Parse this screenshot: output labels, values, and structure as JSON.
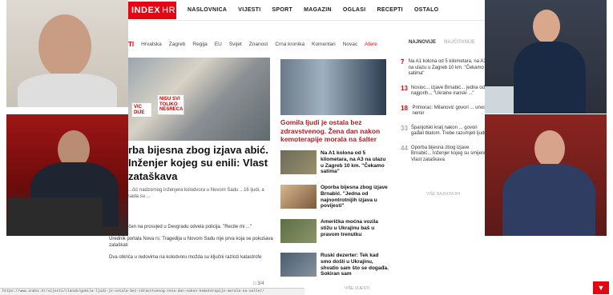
{
  "nav": {
    "logo": "INDEX",
    "logo_suffix": "HR",
    "items": [
      "NASLOVNICA",
      "VIJESTI",
      "SPORT",
      "MAGAZIN",
      "OGLASI",
      "RECEPTI",
      "OSTALO"
    ]
  },
  "subnav": {
    "prefix": "TI",
    "items": [
      "Hrvatska",
      "Zagreb",
      "Regija",
      "EU",
      "Svijet",
      "Znanost",
      "Crna kronika",
      "Komentari",
      "Novac"
    ],
    "alert": "Afere"
  },
  "tabs": {
    "active": "NAJNOVIJE",
    "inactive": "NAJČITANIJE"
  },
  "hero": {
    "signs": [
      "NISU SVI TOLIKO NESRECA",
      "VIC DIJE"
    ],
    "title": "rba bijesna zbog izjava abić. Inženjer kojeg su enili: Vlast zataškava",
    "sub": "...čić nadzornog inženjera kolodvora u Novom Sadu ...16 ljudi, a sada su ... "
  },
  "small_links": [
    "...je povučen na prosvjed u Devgradu odvela policija. \"Recite mi ...\"",
    "Urednik portala Nova rs: Tragedija u Novom Sadu nije prva koja se pokušava zataškati",
    "Dva otkrića u redovima na kolodvoru možda su ključni razlozi katastrofe"
  ],
  "comment_count": "3/4",
  "mid": {
    "title": "Gomila ljudi je ostala bez zdravstvenog. Žena dan nakon kemoterapije morala na šalter",
    "stories": [
      "Na A1 kolona od 5 kilometara, na A3 na ulazu u Zagreb 10 km. \"Čekamo satima\"",
      "Oporba bijesna zbog izjave Brnabić. \"Jedna od najnontrotnijih izjava u povijesti\"",
      "Američka mоćna vozila stižu u Ukrajinu baš u pravom trenutku",
      "Ruski dezerter: Tek kad smo došli u Ukrajinu, shvatio sam što se događa. Sokiran sam"
    ],
    "more": "VIŠE VIJESTI"
  },
  "right_list": [
    {
      "num": "7",
      "text": "Na A1 kolona od 5 kilometara, na A3 na ulazu u Zagreb 10 km. \"Čekamo satima\""
    },
    {
      "num": "13",
      "text": "Nosioc... izjave Brnabić... jedna od najgorih... \"Ukraine iranski ...\""
    },
    {
      "num": "18",
      "text": "Primorac: Milanović govori ... unosi nemir"
    },
    {
      "num": "33",
      "text": "Španjolski kralj nakon ... govori gađali blatom. Trebe razumjeti ljudi"
    },
    {
      "num": "44",
      "text": "Oporba bijesna zbog izjave Brnabić... Inženjer kojeg su smijenili: Vlast zataškava"
    }
  ],
  "right_more": "VIŠE NAJNOVIJIH",
  "status_url": "https://www.index.hr/vijesti/clanak/gomila-ljudi-je-ostala-bez-zdravstvenog-zena-dan-nakon-kemoterapije-morala-na-salter/"
}
